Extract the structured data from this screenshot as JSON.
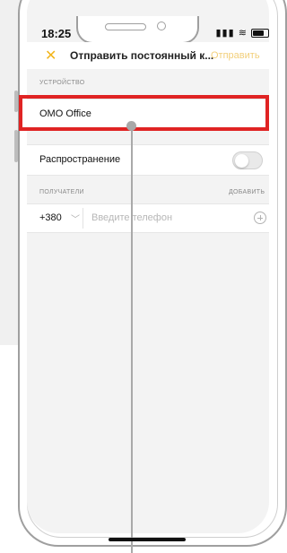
{
  "status_bar": {
    "time": "18:25",
    "icons": [
      "signal-icon",
      "wifi-icon",
      "battery-icon"
    ]
  },
  "navbar": {
    "close_label": "✕",
    "title": "Отправить постоянный к...",
    "action_label": "Отправить"
  },
  "sections": {
    "device": {
      "label": "УСТРОЙСТВО",
      "value": "OMO Office"
    },
    "sharing": {
      "label": "Распространение",
      "enabled": false
    },
    "recipients": {
      "label": "ПОЛУЧАТЕЛИ",
      "add_label": "ДОБАВИТЬ",
      "country_code": "+380",
      "phone_placeholder": "Введите телефон"
    }
  },
  "colors": {
    "accent": "#f2b51c",
    "highlight": "#e02323",
    "background": "#f3f3f3"
  }
}
